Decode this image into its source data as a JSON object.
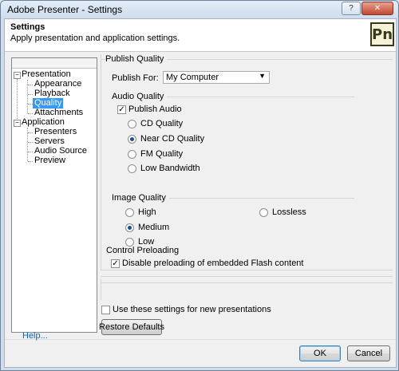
{
  "window": {
    "title": "Adobe Presenter - Settings"
  },
  "header": {
    "title": "Settings",
    "subtitle": "Apply presentation and application settings.",
    "logo_text": "Pn"
  },
  "tree": {
    "items": [
      {
        "label": "Presentation"
      },
      {
        "label": "Appearance"
      },
      {
        "label": "Playback"
      },
      {
        "label": "Quality"
      },
      {
        "label": "Attachments"
      },
      {
        "label": "Application"
      },
      {
        "label": "Presenters"
      },
      {
        "label": "Servers"
      },
      {
        "label": "Audio Source"
      },
      {
        "label": "Preview"
      }
    ],
    "selected": "Quality"
  },
  "publish_quality": {
    "heading": "Publish Quality",
    "publish_for_label": "Publish For:",
    "publish_for_value": "My Computer"
  },
  "audio_quality": {
    "heading": "Audio Quality",
    "publish_audio_label": "Publish Audio",
    "publish_audio_checked": true,
    "options": [
      "CD Quality",
      "Near CD Quality",
      "FM Quality",
      "Low Bandwidth"
    ],
    "selected": "Near CD Quality"
  },
  "image_quality": {
    "heading": "Image Quality",
    "options": [
      "High",
      "Medium",
      "Low",
      "Lossless"
    ],
    "selected": "Medium"
  },
  "control_preloading": {
    "heading": "Control Preloading",
    "disable_label": "Disable preloading of embedded Flash content",
    "disable_checked": true
  },
  "footer": {
    "use_settings_label": "Use these settings for new presentations",
    "use_settings_checked": false,
    "restore_label": "Restore Defaults",
    "help_label": "Help...",
    "ok_label": "OK",
    "cancel_label": "Cancel"
  }
}
